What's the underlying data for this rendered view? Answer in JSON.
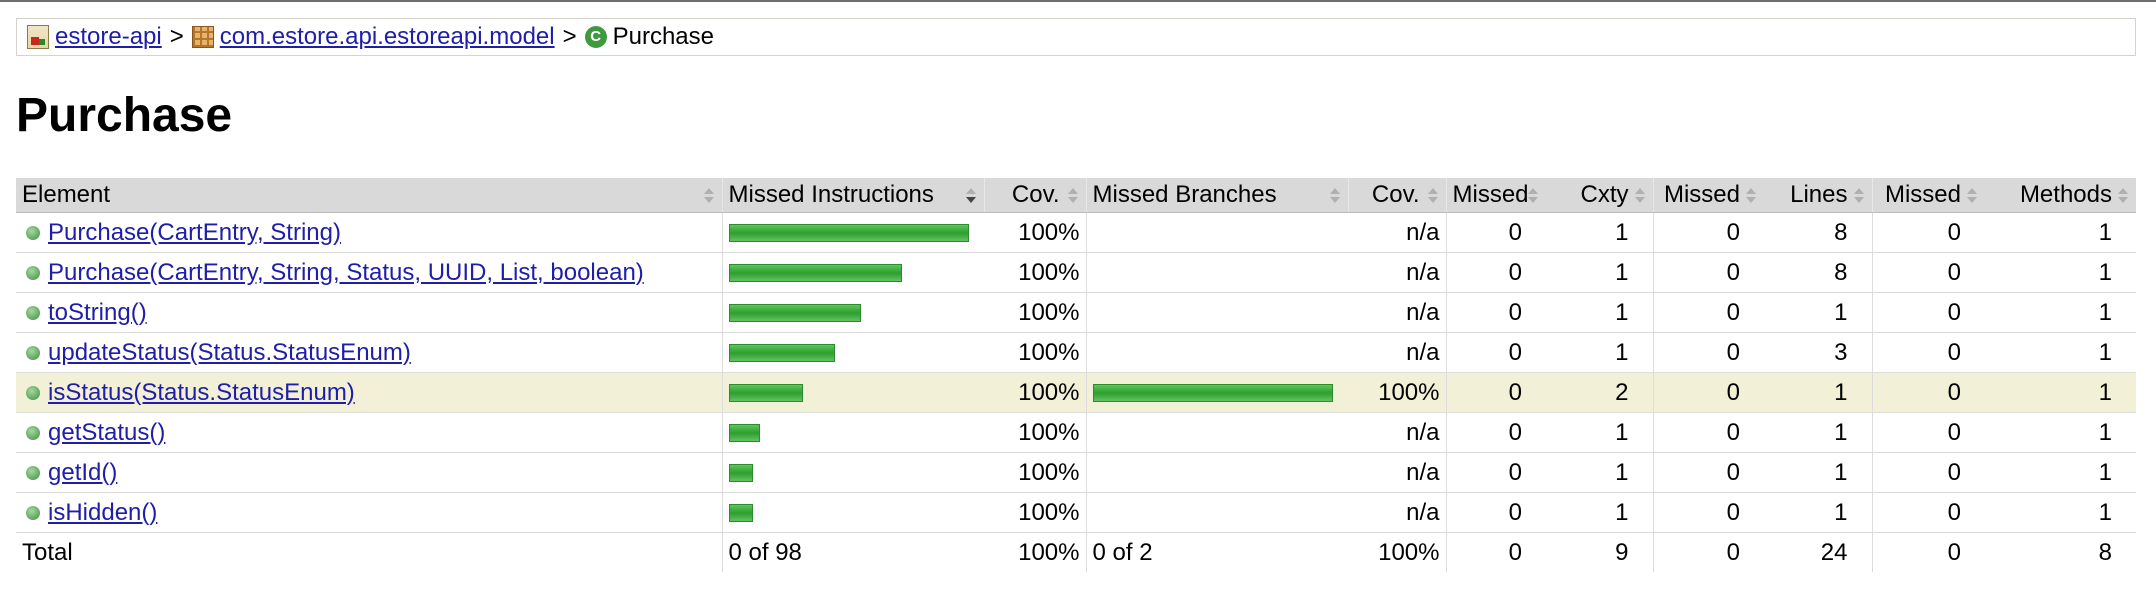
{
  "breadcrumb": {
    "project": "estore-api",
    "package": "com.estore.api.estoreapi.model",
    "current": "Purchase",
    "separator": ">"
  },
  "title": "Purchase",
  "colors": {
    "bar_green": "#3cad3c",
    "highlight_row": "#f2f0d7",
    "link": "#1e1ea8"
  },
  "table": {
    "headers": {
      "element": "Element",
      "missed_instructions": "Missed Instructions",
      "cov1": "Cov.",
      "missed_branches": "Missed Branches",
      "cov2": "Cov.",
      "missed_cxty": "Missed",
      "cxty": "Cxty",
      "missed_lines": "Missed",
      "lines": "Lines",
      "missed_methods": "Missed",
      "methods": "Methods"
    },
    "rows": [
      {
        "name": "Purchase(CartEntry, String)",
        "instr_fraction": 1.0,
        "cov1": "100%",
        "branch_fraction": null,
        "cov2": "n/a",
        "missed_cxty": "0",
        "cxty": "1",
        "missed_lines": "0",
        "lines": "8",
        "missed_methods": "0",
        "methods": "1"
      },
      {
        "name": "Purchase(CartEntry, String, Status, UUID, List, boolean)",
        "instr_fraction": 0.72,
        "cov1": "100%",
        "branch_fraction": null,
        "cov2": "n/a",
        "missed_cxty": "0",
        "cxty": "1",
        "missed_lines": "0",
        "lines": "8",
        "missed_methods": "0",
        "methods": "1"
      },
      {
        "name": "toString()",
        "instr_fraction": 0.55,
        "cov1": "100%",
        "branch_fraction": null,
        "cov2": "n/a",
        "missed_cxty": "0",
        "cxty": "1",
        "missed_lines": "0",
        "lines": "1",
        "missed_methods": "0",
        "methods": "1"
      },
      {
        "name": "updateStatus(Status.StatusEnum)",
        "instr_fraction": 0.44,
        "cov1": "100%",
        "branch_fraction": null,
        "cov2": "n/a",
        "missed_cxty": "0",
        "cxty": "1",
        "missed_lines": "0",
        "lines": "3",
        "missed_methods": "0",
        "methods": "1"
      },
      {
        "name": "isStatus(Status.StatusEnum)",
        "instr_fraction": 0.31,
        "cov1": "100%",
        "branch_fraction": 1.0,
        "cov2": "100%",
        "missed_cxty": "0",
        "cxty": "2",
        "missed_lines": "0",
        "lines": "1",
        "missed_methods": "0",
        "methods": "1",
        "highlight": true
      },
      {
        "name": "getStatus()",
        "instr_fraction": 0.13,
        "cov1": "100%",
        "branch_fraction": null,
        "cov2": "n/a",
        "missed_cxty": "0",
        "cxty": "1",
        "missed_lines": "0",
        "lines": "1",
        "missed_methods": "0",
        "methods": "1"
      },
      {
        "name": "getId()",
        "instr_fraction": 0.1,
        "cov1": "100%",
        "branch_fraction": null,
        "cov2": "n/a",
        "missed_cxty": "0",
        "cxty": "1",
        "missed_lines": "0",
        "lines": "1",
        "missed_methods": "0",
        "methods": "1"
      },
      {
        "name": "isHidden()",
        "instr_fraction": 0.1,
        "cov1": "100%",
        "branch_fraction": null,
        "cov2": "n/a",
        "missed_cxty": "0",
        "cxty": "1",
        "missed_lines": "0",
        "lines": "1",
        "missed_methods": "0",
        "methods": "1"
      }
    ],
    "total": {
      "label": "Total",
      "missed_instructions": "0 of 98",
      "cov1": "100%",
      "missed_branches": "0 of 2",
      "cov2": "100%",
      "missed_cxty": "0",
      "cxty": "9",
      "missed_lines": "0",
      "lines": "24",
      "missed_methods": "0",
      "methods": "8"
    }
  }
}
